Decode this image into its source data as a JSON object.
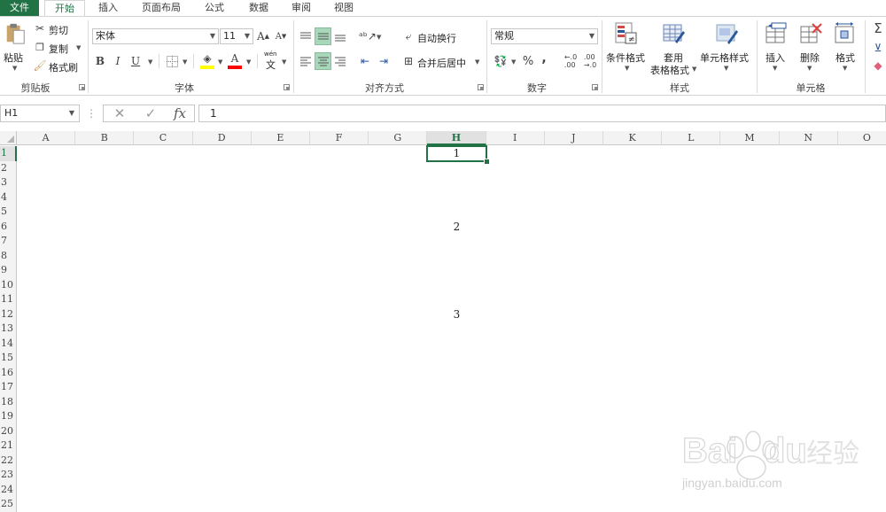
{
  "tabs": [
    {
      "label": "文件"
    },
    {
      "label": "开始"
    },
    {
      "label": "插入"
    },
    {
      "label": "页面布局"
    },
    {
      "label": "公式"
    },
    {
      "label": "数据"
    },
    {
      "label": "审阅"
    },
    {
      "label": "视图"
    }
  ],
  "ribbon": {
    "clipboard": {
      "paste": "粘贴",
      "cut": "剪切",
      "copy": "复制",
      "format_painter": "格式刷",
      "group_label": "剪贴板"
    },
    "font": {
      "font_name": "宋体",
      "font_size": "11",
      "bold": "B",
      "italic": "I",
      "underline": "U",
      "grow": "A",
      "shrink": "A",
      "font_color_glyph": "A",
      "phonetic": "wén",
      "phonetic_char": "文",
      "group_label": "字体"
    },
    "alignment": {
      "wrap_text": "自动换行",
      "merge_center": "合并后居中",
      "group_label": "对齐方式"
    },
    "number": {
      "format": "常规",
      "percent": "%",
      "comma": ",",
      "inc_decimal": "←.0\n.00",
      "group_label": "数字"
    },
    "styles": {
      "conditional": "条件格式",
      "table_format_1": "套用",
      "table_format_2": "表格格式",
      "cell_styles": "单元格样式",
      "group_label": "样式"
    },
    "cells": {
      "insert": "插入",
      "delete": "删除",
      "format": "格式",
      "group_label": "单元格"
    },
    "editing": {
      "sum_glyph": "Σ"
    }
  },
  "formula_bar": {
    "name_box": "H1",
    "fx": "fx",
    "value": "1"
  },
  "columns": [
    "A",
    "B",
    "C",
    "D",
    "E",
    "F",
    "G",
    "H",
    "I",
    "J",
    "K",
    "L",
    "M",
    "N",
    "O"
  ],
  "rows": [
    "1",
    "2",
    "3",
    "4",
    "5",
    "6",
    "7",
    "8",
    "9",
    "10",
    "11",
    "12",
    "13",
    "14",
    "15",
    "16",
    "17",
    "18",
    "19",
    "20",
    "21",
    "22",
    "23",
    "24",
    "25"
  ],
  "cells": [
    {
      "ref": "H1",
      "value": "1"
    },
    {
      "ref": "H6",
      "value": "2"
    },
    {
      "ref": "H12",
      "value": "3"
    }
  ],
  "selected_cell": "H1",
  "colors": {
    "accent": "#217346",
    "selection_fill": "#a8d8b9"
  },
  "watermark": {
    "brand": "Bai",
    "brand2": "du",
    "cn": "经验",
    "url": "jingyan.baidu.com"
  }
}
